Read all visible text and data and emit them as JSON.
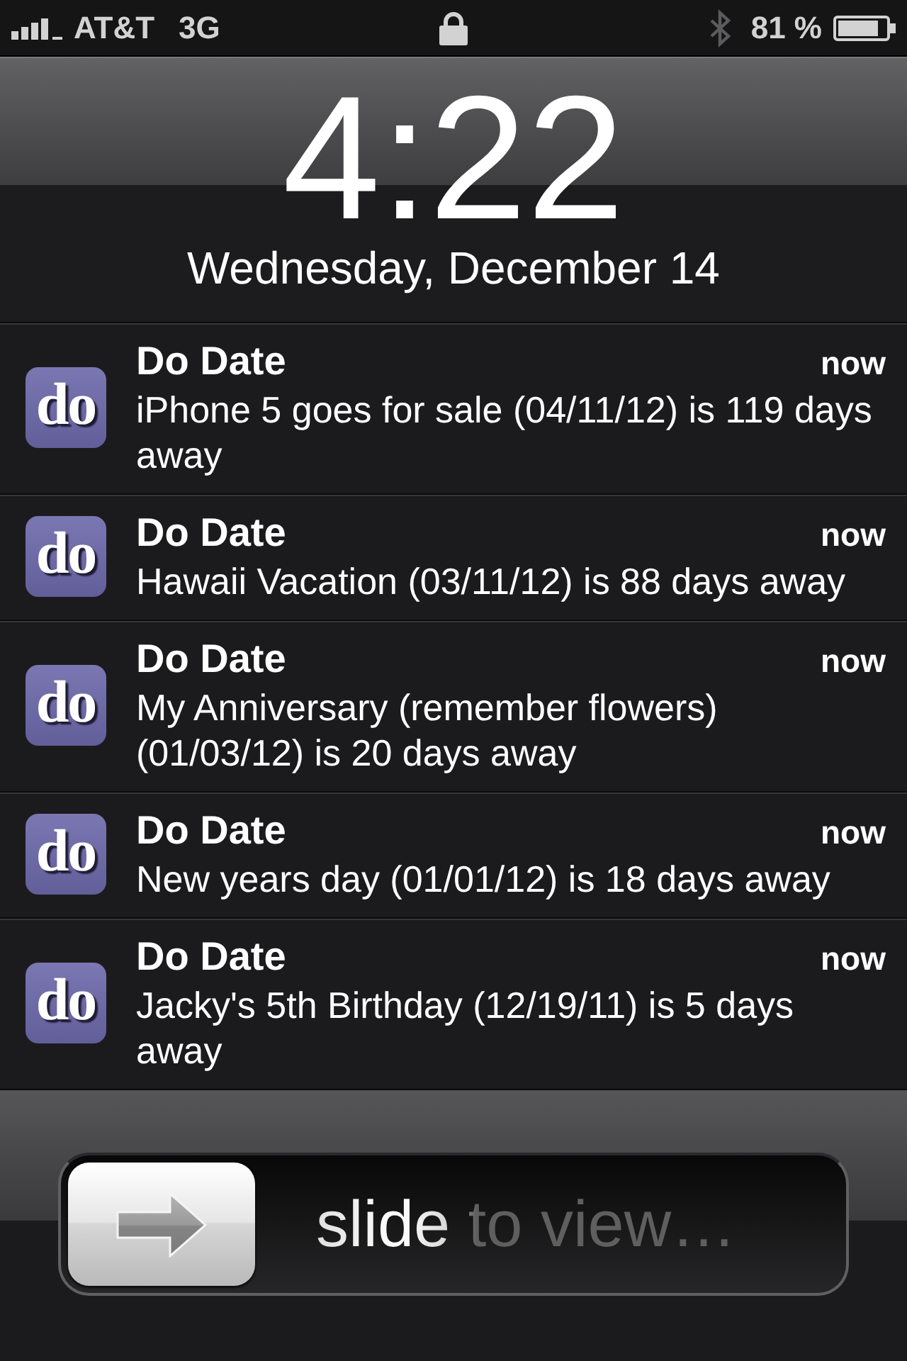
{
  "status_bar": {
    "carrier": "AT&T",
    "network": "3G",
    "battery": "81 %"
  },
  "lock_screen": {
    "time": "4:22",
    "date": "Wednesday, December 14"
  },
  "notifications": [
    {
      "icon_label": "do",
      "app": "Do Date",
      "time": "now",
      "message": "iPhone 5 goes for sale (04/11/12) is 119 days away"
    },
    {
      "icon_label": "do",
      "app": "Do Date",
      "time": "now",
      "message": "Hawaii Vacation (03/11/12) is 88 days away"
    },
    {
      "icon_label": "do",
      "app": "Do Date",
      "time": "now",
      "message": "My Anniversary (remember flowers) (01/03/12) is 20 days away"
    },
    {
      "icon_label": "do",
      "app": "Do Date",
      "time": "now",
      "message": "New years day (01/01/12) is 18 days away"
    },
    {
      "icon_label": "do",
      "app": "Do Date",
      "time": "now",
      "message": "Jacky's 5th Birthday (12/19/11) is 5 days away"
    }
  ],
  "slider": {
    "label": "slide to view…",
    "level": 0
  }
}
